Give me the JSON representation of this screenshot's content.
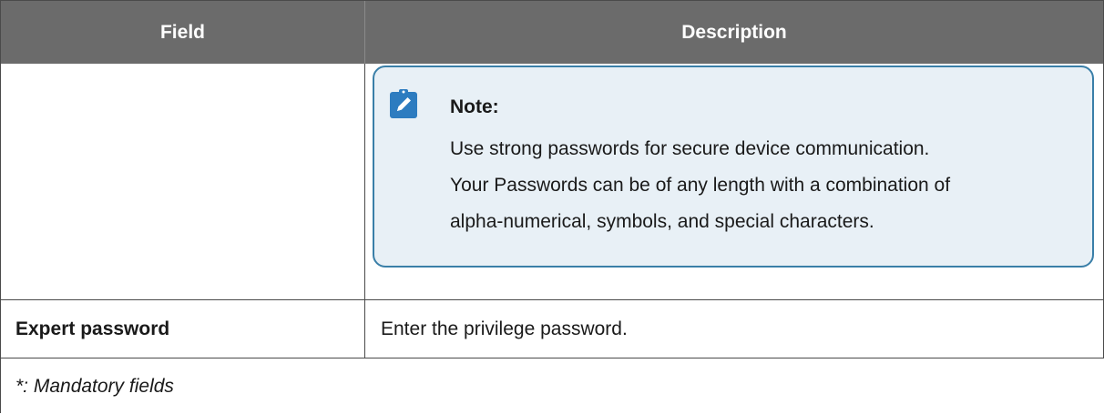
{
  "table": {
    "headers": {
      "field": "Field",
      "description": "Description"
    },
    "note": {
      "title": "Note:",
      "icon": "pencil-note-icon",
      "lines": [
        "Use strong passwords for secure device communication.",
        "Your Passwords can be of any length with a combination of",
        "alpha-numerical, symbols, and special characters."
      ]
    },
    "rows": [
      {
        "field": "Expert password",
        "description": "Enter the privilege password."
      }
    ],
    "footer": "*: Mandatory fields"
  },
  "colors": {
    "header_bg": "#6b6b6b",
    "note_border": "#3a7fa8",
    "note_bg": "#e8f0f6",
    "note_icon": "#2d7cc0"
  }
}
